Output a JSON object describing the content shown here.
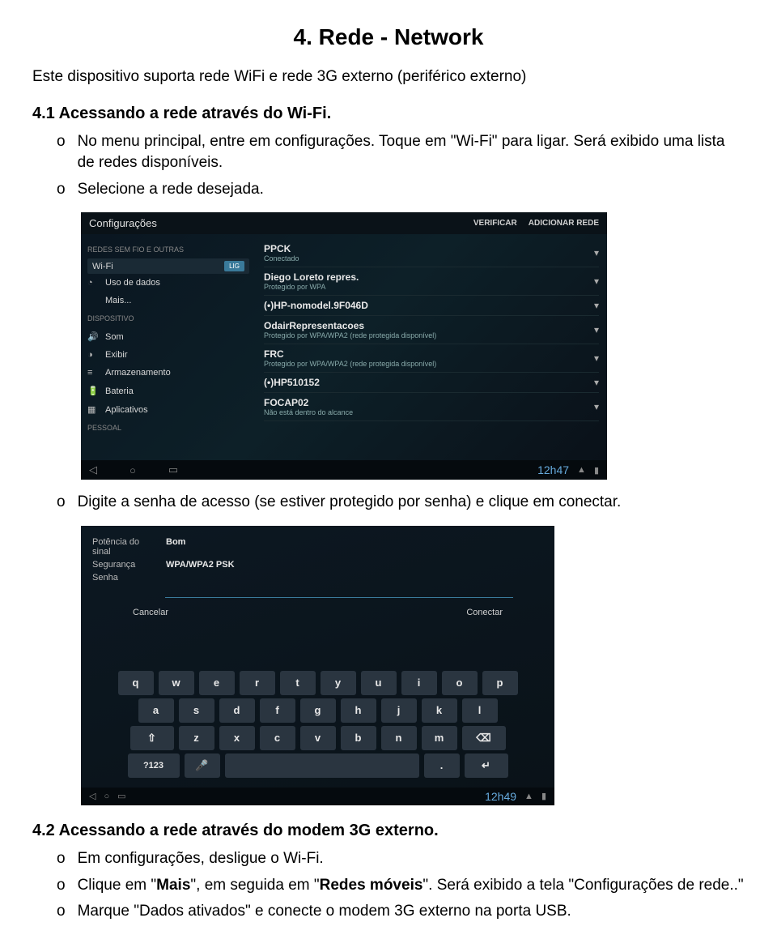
{
  "doc": {
    "h1": "4. Rede - Network",
    "intro": "Este dispositivo suporta rede WiFi e rede 3G externo (periférico externo)",
    "h2a": "4.1 Acessando a rede através do Wi-Fi.",
    "b1a": "No menu principal, entre em configurações. Toque em \"Wi-Fi\" para ligar. Será exibido uma lista de redes disponíveis.",
    "b1b": "Selecione a rede desejada.",
    "b2": "Digite a senha de acesso (se estiver protegido por senha) e clique em conectar.",
    "h2b": "4.2 Acessando a rede através do modem 3G externo.",
    "b3a": "Em configurações, desligue o Wi-Fi.",
    "b3b_pre": "Clique em \"",
    "b3b_b1": "Mais",
    "b3b_mid": "\", em seguida em \"",
    "b3b_b2": "Redes móveis",
    "b3b_post": "\". Será exibido a tela \"Configurações de rede..\"",
    "b3c": "Marque \"Dados ativados\" e conecte o modem 3G externo na porta USB."
  },
  "shot1": {
    "title": "Configurações",
    "verify": "VERIFICAR",
    "add": "ADICIONAR REDE",
    "side_head1": "REDES SEM FIO E OUTRAS",
    "wifi": "Wi-Fi",
    "lig": "LIG",
    "uso": "Uso de dados",
    "mais": "Mais...",
    "side_head2": "DISPOSITIVO",
    "som": "Som",
    "exibir": "Exibir",
    "arm": "Armazenamento",
    "bat": "Bateria",
    "app": "Aplicativos",
    "side_head3": "PESSOAL",
    "nets": [
      {
        "nm": "PPCK",
        "sub": "Conectado"
      },
      {
        "nm": "Diego Loreto repres.",
        "sub": "Protegido por WPA"
      },
      {
        "nm": "(•)HP-nomodel.9F046D",
        "sub": ""
      },
      {
        "nm": "OdairRepresentacoes",
        "sub": "Protegido por WPA/WPA2 (rede protegida disponível)"
      },
      {
        "nm": "FRC",
        "sub": "Protegido por WPA/WPA2 (rede protegida disponível)"
      },
      {
        "nm": "(•)HP510152",
        "sub": ""
      },
      {
        "nm": "FOCAP02",
        "sub": "Não está dentro do alcance"
      }
    ],
    "clock": "12h47"
  },
  "shot2": {
    "pot_l": "Potência do sinal",
    "pot_v": "Bom",
    "seg_l": "Segurança",
    "seg_v": "WPA/WPA2 PSK",
    "sen_l": "Senha",
    "cancel": "Cancelar",
    "connect": "Conectar",
    "row1": [
      "q",
      "w",
      "e",
      "r",
      "t",
      "y",
      "u",
      "i",
      "o",
      "p"
    ],
    "row2": [
      "a",
      "s",
      "d",
      "f",
      "g",
      "h",
      "j",
      "k",
      "l"
    ],
    "row3": [
      "z",
      "x",
      "c",
      "v",
      "b",
      "n",
      "m"
    ],
    "shift": "⇧",
    "bksp": "⌫",
    "num": "?123",
    "ret": "↵",
    "mic": "🎤",
    "gear": "⚙",
    "clock": "12h49"
  }
}
